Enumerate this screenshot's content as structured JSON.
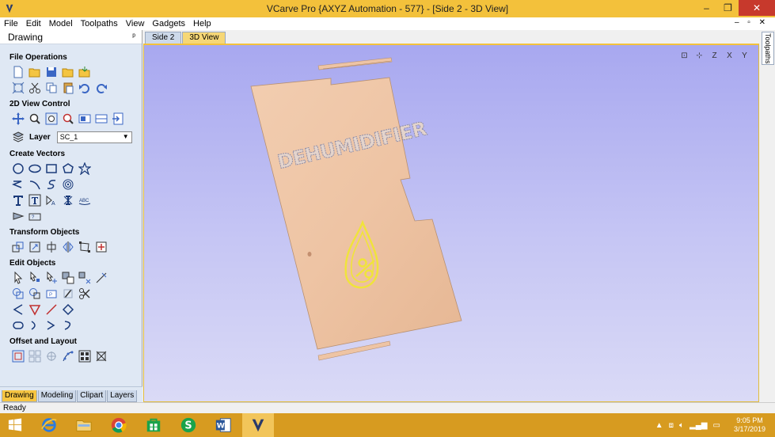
{
  "window": {
    "title": "VCarve Pro {AXYZ Automation - 577} - [Side 2 - 3D View]",
    "minimize": "–",
    "restore": "❐",
    "close": "✕"
  },
  "menu": [
    "File",
    "Edit",
    "Model",
    "Toolpaths",
    "View",
    "Gadgets",
    "Help"
  ],
  "mdi_controls": "– ▫ ✕",
  "left_panel": {
    "title": "Drawing",
    "pin": "ᵖ",
    "sections": {
      "file_operations": "File Operations",
      "view_control": "2D View Control",
      "create_vectors": "Create Vectors",
      "transform_objects": "Transform Objects",
      "edit_objects": "Edit Objects",
      "offset_layout": "Offset and Layout"
    },
    "layer_label": "Layer",
    "layer_value": "SC_1",
    "bottom_tabs": [
      "Drawing",
      "Modeling",
      "Clipart",
      "Layers"
    ]
  },
  "doc_tabs": [
    "Side 2",
    "3D View"
  ],
  "right_tab": "Toolpaths",
  "view_icons": [
    "⊡",
    "⊹",
    "Z",
    "X",
    "Y"
  ],
  "scene": {
    "carved_text": "DEHUMIDIFIER",
    "wood_color": "#eec4a4",
    "engrave_color": "#f0e43a"
  },
  "status": "Ready",
  "clock": {
    "time": "9:05 PM",
    "date": "3/17/2019"
  },
  "colors": {
    "title_bar": "#f3c13b",
    "taskbar": "#d79b20",
    "panel_bg": "#dfe8f4"
  }
}
